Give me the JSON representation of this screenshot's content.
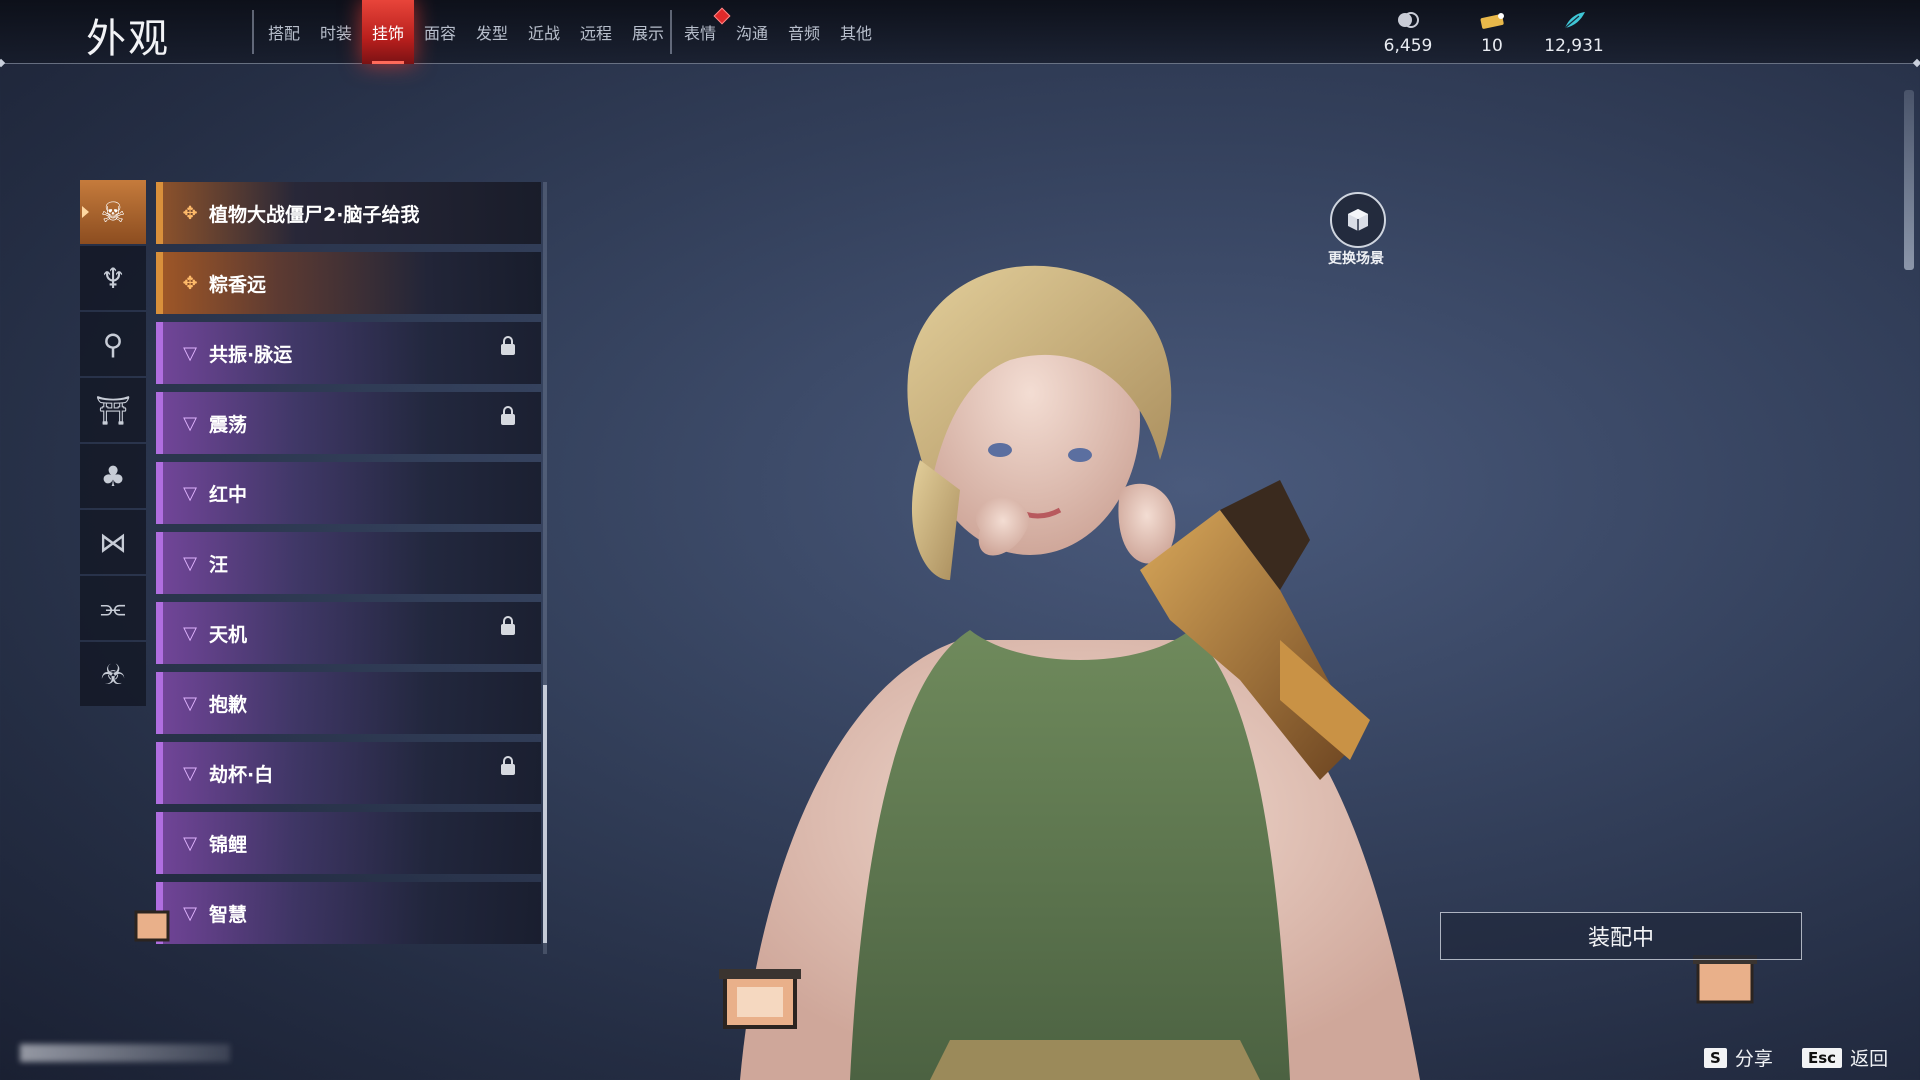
{
  "header": {
    "title": "外观",
    "tabs": [
      {
        "label": "搭配",
        "active": false,
        "badge": false
      },
      {
        "label": "时装",
        "active": false,
        "badge": false
      },
      {
        "label": "挂饰",
        "active": true,
        "badge": false
      },
      {
        "label": "面容",
        "active": false,
        "badge": false
      },
      {
        "label": "发型",
        "active": false,
        "badge": false
      },
      {
        "label": "近战",
        "active": false,
        "badge": false
      },
      {
        "label": "远程",
        "active": false,
        "badge": false
      },
      {
        "label": "展示",
        "active": false,
        "badge": false
      },
      {
        "label": "表情",
        "active": false,
        "badge": true
      },
      {
        "label": "沟通",
        "active": false,
        "badge": false
      },
      {
        "label": "音频",
        "active": false,
        "badge": false
      },
      {
        "label": "其他",
        "active": false,
        "badge": false
      }
    ],
    "currencies": [
      {
        "icon": "coin-stack-icon",
        "value": "6,459",
        "color": "#c9ccd6"
      },
      {
        "icon": "ticket-icon",
        "value": "10",
        "color": "#e8b84a"
      },
      {
        "icon": "feather-icon",
        "value": "12,931",
        "color": "#3fc6d6"
      }
    ]
  },
  "categories": [
    {
      "icon": "skull-ornament-icon",
      "active": true
    },
    {
      "icon": "back-ornament-icon",
      "active": false
    },
    {
      "icon": "waist-ornament-icon",
      "active": false
    },
    {
      "icon": "hat-icon",
      "active": false
    },
    {
      "icon": "cape-icon",
      "active": false
    },
    {
      "icon": "bow-ornament-icon",
      "active": false
    },
    {
      "icon": "wings-icon",
      "active": false
    },
    {
      "icon": "demon-mask-icon",
      "active": false
    }
  ],
  "items": [
    {
      "label": "植物大战僵尸2·脑子给我",
      "rarity": "gold",
      "locked": false
    },
    {
      "label": "粽香远",
      "rarity": "gold",
      "locked": false
    },
    {
      "label": "共振·脉运",
      "rarity": "purple",
      "locked": true
    },
    {
      "label": "震荡",
      "rarity": "purple",
      "locked": true
    },
    {
      "label": "红中",
      "rarity": "purple",
      "locked": false
    },
    {
      "label": "汪",
      "rarity": "purple",
      "locked": false
    },
    {
      "label": "天机",
      "rarity": "purple",
      "locked": true
    },
    {
      "label": "抱歉",
      "rarity": "purple",
      "locked": false
    },
    {
      "label": "劫杯·白",
      "rarity": "purple",
      "locked": true
    },
    {
      "label": "锦鲤",
      "rarity": "purple",
      "locked": false
    },
    {
      "label": "智慧",
      "rarity": "purple",
      "locked": false
    }
  ],
  "scene": {
    "label": "更换场景"
  },
  "equip": {
    "label": "装配中"
  },
  "hints": [
    {
      "key": "S",
      "label": "分享"
    },
    {
      "key": "Esc",
      "label": "返回"
    }
  ]
}
